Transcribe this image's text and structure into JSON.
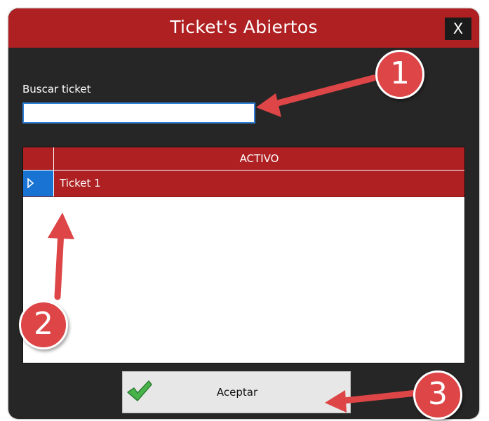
{
  "window": {
    "title": "Ticket's Abiertos",
    "close_label": "X"
  },
  "search": {
    "label": "Buscar ticket",
    "value": "",
    "placeholder": ""
  },
  "grid": {
    "columns": [
      "ACTIVO"
    ],
    "rows": [
      {
        "label": "Ticket 1",
        "selected": true
      }
    ]
  },
  "buttons": {
    "accept_label": "Aceptar"
  },
  "annotations": [
    "1",
    "2",
    "3"
  ],
  "colors": {
    "titlebar": "#ae2022",
    "window_bg": "#262626",
    "row_selected": "#ae2022",
    "row_selector": "#1873d3",
    "annotation": "#dd4547"
  },
  "icons": {
    "close": "close-icon",
    "row_pointer": "row-pointer-icon",
    "accept": "checkmark-icon"
  }
}
